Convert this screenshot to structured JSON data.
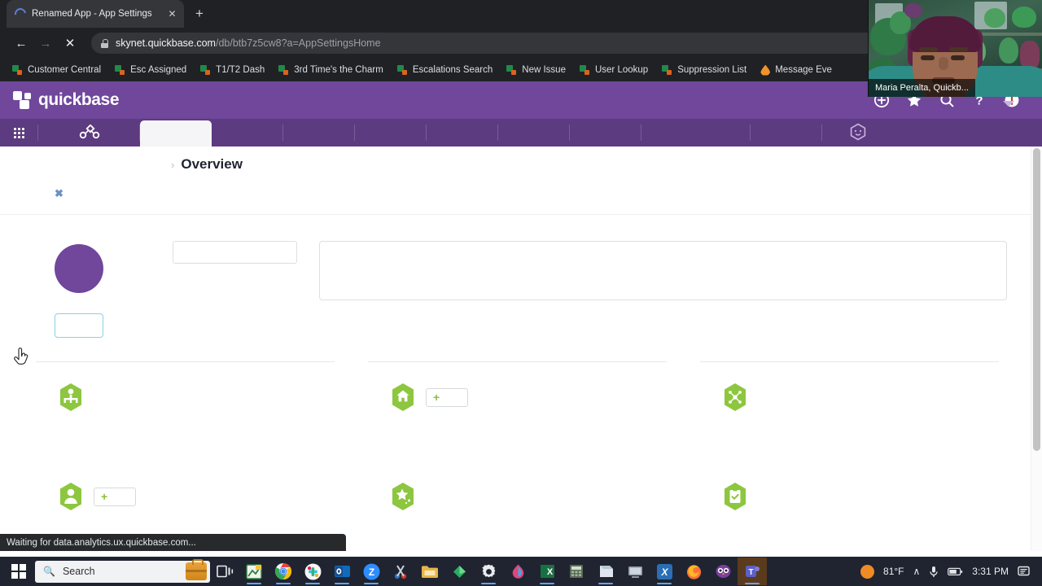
{
  "browser": {
    "tab": {
      "title": "Renamed App - App Settings",
      "spinner": "loading-spinner",
      "close_label": "✕"
    },
    "new_tab_label": "+",
    "nav": {
      "back": "←",
      "forward": "→",
      "stop": "✕"
    },
    "address": {
      "host": "skynet.quickbase.com",
      "path": "/db/btb7z5cw8?a=AppSettingsHome",
      "lock": "lock-icon",
      "search_icon": "⌕"
    },
    "bookmarks": [
      {
        "label": "Customer Central",
        "icon": "quickbase-favicon"
      },
      {
        "label": "Esc Assigned",
        "icon": "quickbase-favicon"
      },
      {
        "label": "T1/T2 Dash",
        "icon": "quickbase-favicon"
      },
      {
        "label": "3rd Time's the Charm",
        "icon": "quickbase-favicon"
      },
      {
        "label": "Escalations Search",
        "icon": "quickbase-favicon"
      },
      {
        "label": "New Issue",
        "icon": "quickbase-favicon"
      },
      {
        "label": "User Lookup",
        "icon": "quickbase-favicon"
      },
      {
        "label": "Suppression List",
        "icon": "quickbase-favicon"
      },
      {
        "label": "Message Eve",
        "icon": "flame-favicon"
      }
    ]
  },
  "quickbase": {
    "brand": "quickbase",
    "brand_color": "#70479b",
    "tabstrip_color": "#5d3b80",
    "header_icons": [
      {
        "name": "plus-circle-icon"
      },
      {
        "name": "star-icon"
      },
      {
        "name": "search-icon"
      },
      {
        "name": "help-icon"
      },
      {
        "name": "alert-icon"
      }
    ],
    "user_caret": "chevron-down-icon",
    "nav": {
      "apps_grid": "apps-grid-icon",
      "pipelines": "pipelines-icon",
      "cube": "cube-icon",
      "tabs": [
        {
          "label": "",
          "active": true
        },
        {
          "label": "",
          "active": false
        },
        {
          "label": "",
          "active": false
        },
        {
          "label": "",
          "active": false
        },
        {
          "label": "",
          "active": false
        },
        {
          "label": "",
          "active": false
        },
        {
          "label": "",
          "active": false
        },
        {
          "label": "",
          "active": false
        },
        {
          "label": "",
          "active": false
        },
        {
          "label": "",
          "active": false
        }
      ]
    },
    "breadcrumb": {
      "chevron": "›",
      "title": "Overview"
    },
    "banner": {
      "close": "✖"
    },
    "fields": {
      "app_name": {
        "value": "",
        "placeholder": ""
      },
      "app_description": {
        "value": "",
        "placeholder": ""
      }
    },
    "avatar": {
      "name": "app-avatar",
      "color": "#70479b"
    },
    "outline_button": {
      "label": "",
      "border_color": "#8ecfe4"
    },
    "columns": [
      {
        "name": "column-one",
        "items": [
          {
            "icon": "org-chart-hexagon-icon",
            "label": "",
            "has_add": false
          },
          {
            "icon": "user-hexagon-icon",
            "label": "",
            "has_add": true,
            "add_label": "+"
          }
        ]
      },
      {
        "name": "column-two",
        "items": [
          {
            "icon": "home-hexagon-icon",
            "label": "",
            "has_add": true,
            "add_label": "+"
          },
          {
            "icon": "star-hexagon-icon",
            "label": "",
            "has_add": false
          }
        ]
      },
      {
        "name": "column-three",
        "items": [
          {
            "icon": "network-hexagon-icon",
            "label": "",
            "has_add": false
          },
          {
            "icon": "clipboard-check-hexagon-icon",
            "label": "",
            "has_add": false
          }
        ]
      }
    ],
    "hex_color": "#8dc63f"
  },
  "status_bar": {
    "text": "Waiting for data.analytics.ux.quickbase.com..."
  },
  "webcam": {
    "label": "Maria Peralta, Quickb..."
  },
  "taskbar": {
    "start": "windows-start-icon",
    "search": {
      "placeholder": "Search",
      "icon": "search-icon",
      "badge": "briefcase-icon"
    },
    "items": [
      {
        "name": "task-view-icon"
      },
      {
        "name": "excel-green-icon"
      },
      {
        "name": "chrome-icon"
      },
      {
        "name": "slack-icon"
      },
      {
        "name": "outlook-icon"
      },
      {
        "name": "zoom-icon"
      },
      {
        "name": "snipping-tool-icon"
      },
      {
        "name": "file-explorer-icon"
      },
      {
        "name": "green-diamond-icon"
      },
      {
        "name": "settings-gear-icon"
      },
      {
        "name": "paint-icon"
      },
      {
        "name": "excel-icon"
      },
      {
        "name": "calculator-icon"
      },
      {
        "name": "notepad-icon"
      },
      {
        "name": "remote-desktop-icon"
      },
      {
        "name": "x-blue-icon"
      },
      {
        "name": "firefox-icon"
      },
      {
        "name": "owl-icon"
      },
      {
        "name": "teams-icon"
      }
    ],
    "tray": {
      "weather_icon": "sun-icon",
      "temperature": "81°F",
      "chevron": "∧",
      "mic": "microphone-icon",
      "battery": "battery-icon",
      "time": "3:31 PM",
      "notifications": "notification-icon"
    }
  }
}
